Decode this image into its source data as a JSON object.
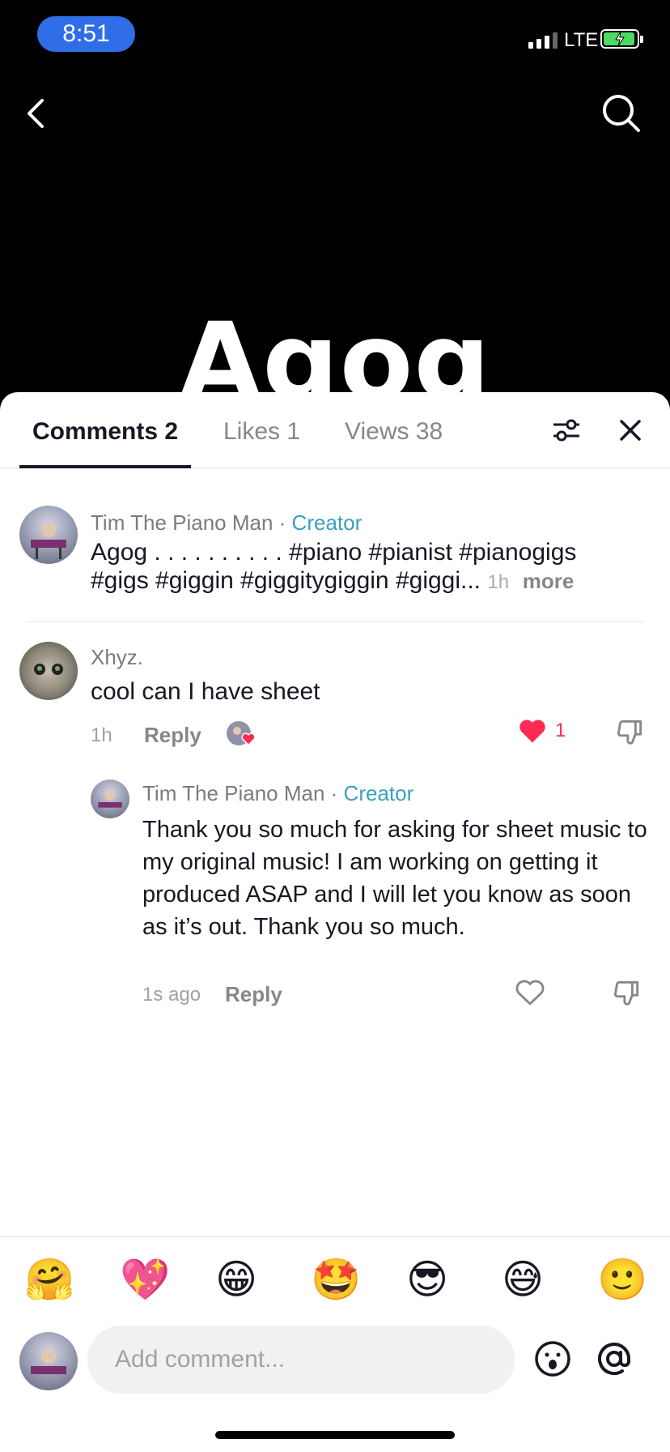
{
  "status_bar": {
    "time": "8:51",
    "network": "LTE"
  },
  "video": {
    "title": "Agog"
  },
  "tabs": [
    {
      "label": "Comments 2"
    },
    {
      "label": "Likes 1"
    },
    {
      "label": "Views 38"
    }
  ],
  "comments": [
    {
      "author": "Tim The Piano Man",
      "separator": " · ",
      "badge": "Creator",
      "text": "Agog . . . . . . . . . . #piano #pianist #pianogigs #gigs #giggin #giggitygiggin #giggi...",
      "time": "1h",
      "more_label": "more"
    },
    {
      "author": "Xhyz.",
      "text": "cool can I have sheet",
      "time": "1h",
      "reply_label": "Reply",
      "like_count": "1",
      "replies": [
        {
          "author": "Tim The Piano Man",
          "separator": " · ",
          "badge": "Creator",
          "text": "Thank you so much for asking for sheet music to my original music! I am working on getting it produced ASAP and I will let you know as soon as it’s out. Thank you so much.",
          "time": "1s ago",
          "reply_label": "Reply"
        }
      ]
    }
  ],
  "emoji_bar": [
    "🤗",
    "💖",
    "😁",
    "🤩",
    "😎",
    "😅",
    "🙂"
  ],
  "composer": {
    "placeholder": "Add comment...",
    "emoji_icon": "emoji-face-icon",
    "mention_icon": "at-sign-icon"
  },
  "colors": {
    "creator_badge": "#3aa0be",
    "like_red": "#fe2c55",
    "time_pill": "#2f6ee6"
  }
}
